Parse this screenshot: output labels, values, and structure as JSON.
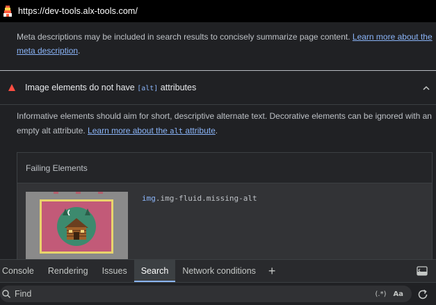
{
  "browser": {
    "url": "https://dev-tools.alx-tools.com/"
  },
  "meta_description": {
    "text": "Meta descriptions may be included in search results to concisely summarize page content. ",
    "link_text": "Learn more about the meta description",
    "suffix": "."
  },
  "audit": {
    "title_before": "Image elements do not have ",
    "title_code": "[alt]",
    "title_after": " attributes",
    "desc_text": "Informative elements should aim for short, descriptive alternate text. Decorative elements can be ignored with an empty alt attribute. ",
    "link_before": "Learn more about the ",
    "link_code": "alt",
    "link_after": " attribute",
    "desc_suffix": ".",
    "status_color": "#ff4e42"
  },
  "failing_elements": {
    "header": "Failing Elements",
    "rows": [
      {
        "selector_tag": "img",
        "selector_rest": ".img-fluid.missing-alt"
      }
    ]
  },
  "drawer": {
    "tabs": [
      {
        "label": "Console",
        "active": false
      },
      {
        "label": "Rendering",
        "active": false
      },
      {
        "label": "Issues",
        "active": false
      },
      {
        "label": "Search",
        "active": true
      },
      {
        "label": "Network conditions",
        "active": false
      }
    ],
    "add_tab": "+"
  },
  "search": {
    "placeholder": "Find",
    "regex_label": "(.*)",
    "case_label": "Aa"
  },
  "colors": {
    "accent": "#8ab4f8",
    "fail": "#ff4e42",
    "background": "#202124"
  }
}
